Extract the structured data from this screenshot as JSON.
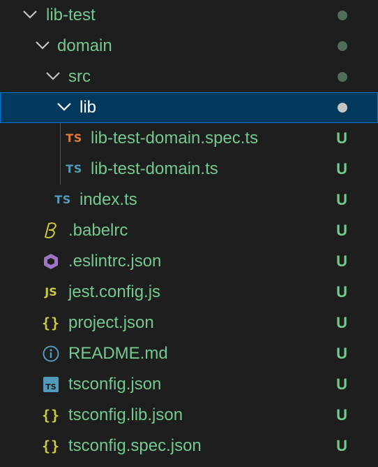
{
  "explorer": {
    "items": [
      {
        "label": "lib-test",
        "kind": "folder",
        "icon": "chevron-down-icon",
        "decoration": "dot"
      },
      {
        "label": "domain",
        "kind": "folder",
        "icon": "chevron-down-icon",
        "decoration": "dot"
      },
      {
        "label": "src",
        "kind": "folder",
        "icon": "chevron-down-icon",
        "decoration": "dot"
      },
      {
        "label": "lib",
        "kind": "folder",
        "icon": "chevron-down-icon",
        "decoration": "dot",
        "selected": true
      },
      {
        "label": "lib-test-domain.spec.ts",
        "kind": "file",
        "icon": "typescript-test-icon",
        "icon_text": "TS",
        "icon_color": "#e37933",
        "status": "U"
      },
      {
        "label": "lib-test-domain.ts",
        "kind": "file",
        "icon": "typescript-icon",
        "icon_text": "TS",
        "icon_color": "#519aba",
        "status": "U"
      },
      {
        "label": "index.ts",
        "kind": "file",
        "icon": "typescript-icon",
        "icon_text": "TS",
        "icon_color": "#519aba",
        "status": "U"
      },
      {
        "label": ".babelrc",
        "kind": "file",
        "icon": "babel-icon",
        "icon_color": "#cbcb41",
        "status": "U"
      },
      {
        "label": ".eslintrc.json",
        "kind": "file",
        "icon": "eslint-icon",
        "icon_color": "#a074c4",
        "status": "U"
      },
      {
        "label": "jest.config.js",
        "kind": "file",
        "icon": "javascript-icon",
        "icon_text": "JS",
        "icon_color": "#cbcb41",
        "status": "U"
      },
      {
        "label": "project.json",
        "kind": "file",
        "icon": "json-braces-icon",
        "icon_text": "{}",
        "icon_color": "#cbcb41",
        "status": "U"
      },
      {
        "label": "README.md",
        "kind": "file",
        "icon": "info-icon",
        "icon_color": "#519aba",
        "status": "U"
      },
      {
        "label": "tsconfig.json",
        "kind": "file",
        "icon": "tsconfig-icon",
        "icon_text": "TS",
        "icon_color": "#519aba",
        "status": "U"
      },
      {
        "label": "tsconfig.lib.json",
        "kind": "file",
        "icon": "json-braces-icon",
        "icon_text": "{}",
        "icon_color": "#cbcb41",
        "status": "U"
      },
      {
        "label": "tsconfig.spec.json",
        "kind": "file",
        "icon": "json-braces-icon",
        "icon_text": "{}",
        "icon_color": "#cbcb41",
        "status": "U"
      }
    ]
  },
  "colors": {
    "background": "#1e1e1e",
    "untracked": "#73c991",
    "selected_bg": "#04395e",
    "selected_border": "#0078d4"
  }
}
